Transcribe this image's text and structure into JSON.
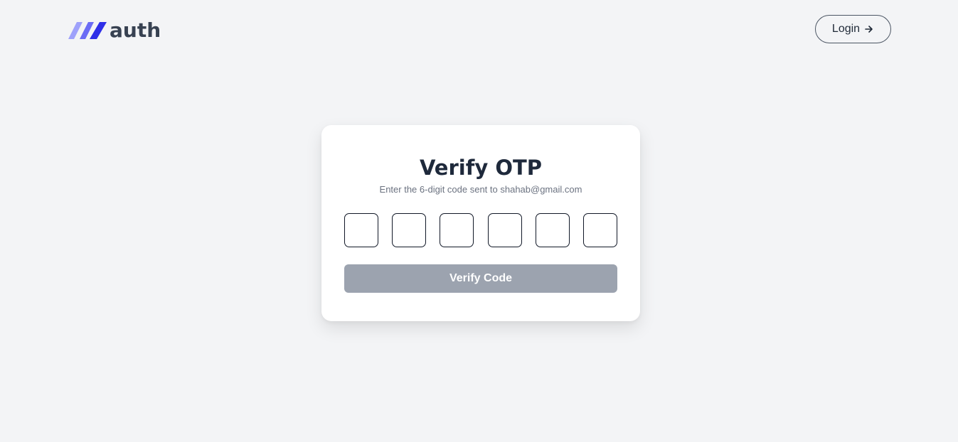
{
  "header": {
    "logo_text": "auth",
    "login_label": "Login"
  },
  "card": {
    "title": "Verify OTP",
    "subtitle": "Enter the 6-digit code sent to shahab@gmail.com",
    "otp_digits": [
      "",
      "",
      "",
      "",
      "",
      ""
    ],
    "verify_label": "Verify Code"
  },
  "colors": {
    "background": "#f3f4f6",
    "logo_stripe_light": "#8b8cf8",
    "logo_stripe_dark": "#4338ca",
    "title": "#1e293b",
    "button_disabled": "#9ca3af"
  },
  "icons": {
    "logo": "three-slanted-stripes-icon",
    "login_arrow": "arrow-right-icon"
  }
}
